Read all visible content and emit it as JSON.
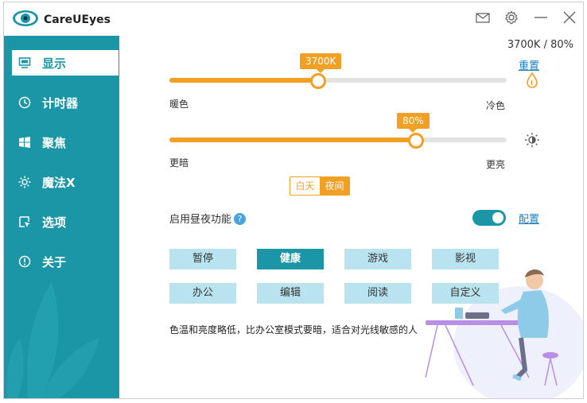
{
  "app": {
    "title": "CareUEyes"
  },
  "colors": {
    "accent": "#1a96a6",
    "slider": "#f2a024",
    "mode_button": "#b9e4ef",
    "link": "#1a7fc0"
  },
  "titlebar": {
    "icons": [
      "mail-icon",
      "gear-icon",
      "minimize-icon",
      "close-icon"
    ]
  },
  "sidebar": {
    "items": [
      {
        "label": "显示",
        "icon": "monitor-icon",
        "active": true
      },
      {
        "label": "计时器",
        "icon": "clock-icon",
        "active": false
      },
      {
        "label": "聚焦",
        "icon": "windows-icon",
        "active": false
      },
      {
        "label": "魔法X",
        "icon": "sparkle-icon",
        "active": false
      },
      {
        "label": "选项",
        "icon": "cursor-box-icon",
        "active": false
      },
      {
        "label": "关于",
        "icon": "info-icon",
        "active": false
      }
    ]
  },
  "main": {
    "status_text": "3700K / 80%",
    "reset_label": "重置",
    "temp_slider": {
      "tooltip": "3700K",
      "value": 0.44,
      "left_label": "暖色",
      "right_label": "冷色",
      "icon": "water-drop-icon"
    },
    "brightness_slider": {
      "tooltip": "80%",
      "value": 0.73,
      "left_label": "更暗",
      "right_label": "更亮",
      "icon": "brightness-icon"
    },
    "day_label": "白天",
    "night_label": "夜间",
    "day_night_selected": "夜间",
    "daynight_feature_label": "启用昼夜功能",
    "help_glyph": "?",
    "daynight_enabled": true,
    "config_label": "配置",
    "modes": [
      "暂停",
      "健康",
      "游戏",
      "影视",
      "办公",
      "编辑",
      "阅读",
      "自定义"
    ],
    "active_mode": "健康",
    "description": "色温和亮度略低，比办公室模式要暗，适合对光线敏感的人"
  }
}
